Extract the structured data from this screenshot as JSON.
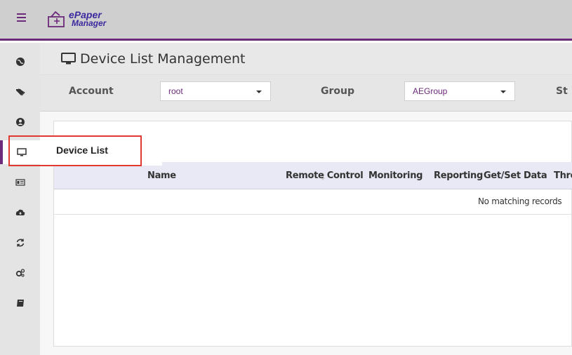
{
  "app": {
    "logo_line1": "ePaper",
    "logo_line2": "Manager"
  },
  "sidebar": {
    "items": [
      {
        "icon": "globe-icon"
      },
      {
        "icon": "tags-icon"
      },
      {
        "icon": "user-circle-icon"
      },
      {
        "icon": "monitor-icon",
        "active": true
      },
      {
        "icon": "id-card-icon"
      },
      {
        "icon": "cloud-upload-icon"
      },
      {
        "icon": "refresh-icon"
      },
      {
        "icon": "cogs-icon"
      },
      {
        "icon": "book-icon"
      }
    ],
    "flyout_label": "Device List"
  },
  "page": {
    "title": "Device List Management"
  },
  "filters": {
    "account_label": "Account",
    "account_value": "root",
    "group_label": "Group",
    "group_value": "AEGroup",
    "status_label_partial": "St"
  },
  "table": {
    "columns": [
      "Name",
      "Remote Control",
      "Monitoring",
      "Reporting",
      "Get/Set Data",
      "Thre"
    ],
    "empty_text": "No matching records"
  },
  "colors": {
    "accent": "#6b2a7a",
    "highlight": "#e0392f",
    "header_bg": "#e9e9f5"
  }
}
